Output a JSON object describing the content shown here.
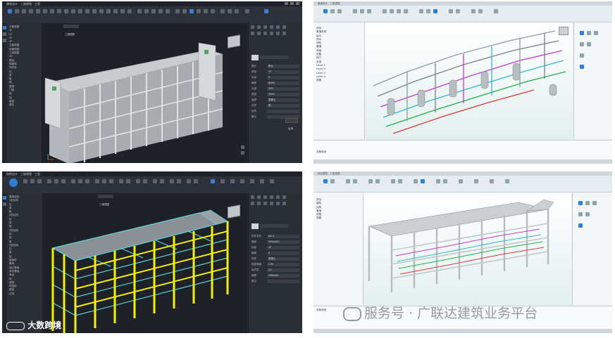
{
  "screens": {
    "top_left": {
      "title": "建筑设计 - 三维视图 - 工程",
      "tabs": [
        "视图",
        "工具",
        "模型"
      ],
      "view_tab": "三维视图",
      "tree_items": [
        "平面视图",
        "1F",
        "2F",
        "3F",
        "4F",
        "立面视图",
        "剖面视图",
        "三维视图",
        "3D",
        "图纸",
        "明细表",
        "构件库",
        "柱",
        "梁",
        "板",
        "墙",
        "楼梯",
        "门窗",
        "族",
        "组",
        "链接",
        "属性"
      ],
      "prop_labels": [
        "基点",
        "类型",
        "标高",
        "偏移",
        "长度",
        "宽度",
        "高度",
        "材质",
        "结构",
        "备注"
      ],
      "prop_values": [
        "默认",
        "1F",
        "0",
        "6000",
        "300",
        "3000",
        "混凝土",
        "是"
      ],
      "apply_label": "应用"
    },
    "top_right": {
      "title": "管道设计 - 三维视图",
      "tree_items": [
        "项目",
        "管道系统",
        "给水",
        "排水",
        "消防",
        "暖通",
        "风管",
        "设备",
        "阀门",
        "支架",
        "Level 1",
        "Level 2",
        "Level 3",
        "Level 4",
        "视图"
      ],
      "status_text": "准备就绪"
    },
    "bottom_left": {
      "title": "结构设计 - 三维视图 - 工程",
      "view_tab": "三维视图",
      "tree_items": [
        "建筑结构",
        "1层结构",
        "柱",
        "梁",
        "板",
        "2层结构",
        "柱",
        "梁",
        "板",
        "3层结构",
        "柱",
        "梁",
        "板",
        "4层结构",
        "柱",
        "梁",
        "板",
        "屋面层",
        "基础",
        "独立基础",
        "条形基础",
        "承台",
        "桩",
        "钢筋",
        "构造柱",
        "圈梁",
        "过梁"
      ],
      "prop_labels": [
        "构件名称",
        "截面",
        "标高",
        "偏移",
        "材质",
        "强度等级",
        "保护层",
        "钢筋",
        "备注"
      ],
      "prop_values": [
        "KZ-1",
        "500x500",
        "1F",
        "0",
        "混凝土",
        "C30",
        "25",
        "HRB400"
      ]
    },
    "bottom_right": {
      "title": "综合模型 - 三维视图",
      "tree_items": [
        "项目",
        "建筑",
        "结构",
        "管道",
        "设备",
        "视图"
      ],
      "status_text": "准备就绪"
    }
  },
  "watermark": {
    "bottom_left_text": "大数跨境",
    "bottom_right_text": "服务号 · 广联达建筑业务平台"
  },
  "colors": {
    "dark_bg": "#262a31",
    "light_bg": "#e9eef0",
    "structure_yellow": "#f2ee10",
    "slab_cyan": "#5fd3d8",
    "accent_blue": "#2d7fd3"
  }
}
